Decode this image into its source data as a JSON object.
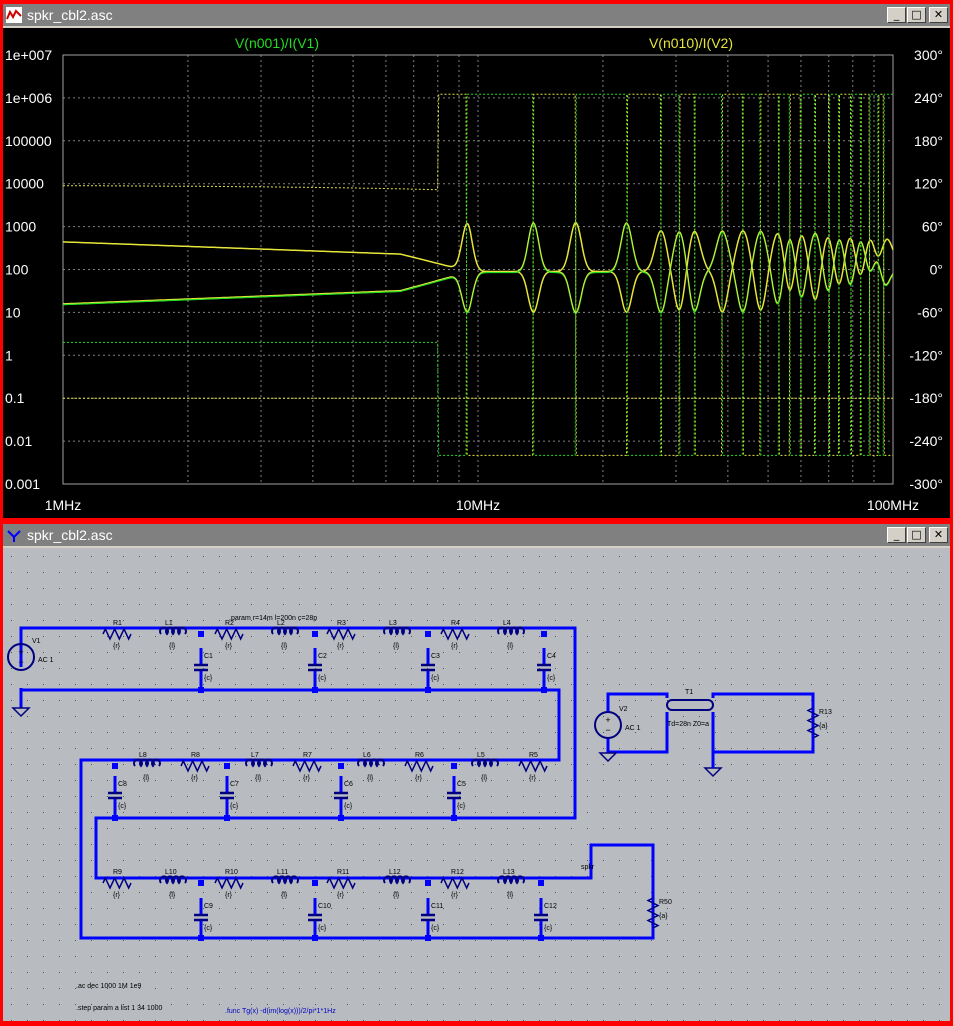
{
  "windows": {
    "waveform": {
      "title": "spkr_cbl2.asc"
    },
    "schematic": {
      "title": "spkr_cbl2.asc"
    }
  },
  "window_buttons": {
    "minimize": "_",
    "maximize": "□",
    "close": "✕"
  },
  "colors": {
    "trace1": "#22dd22",
    "trace2": "#e6e63a",
    "wire": "#0000ff",
    "component": "#000080"
  },
  "chart_data": {
    "type": "line",
    "series": [
      {
        "name": "V(n001)/I(V1)"
      },
      {
        "name": "V(n010)/I(V2)"
      }
    ],
    "x_scale": "log",
    "xlim": [
      "1MHz",
      "100MHz"
    ],
    "x_ticks": [
      "1MHz",
      "10MHz",
      "100MHz"
    ],
    "y_scale": "log",
    "ylim": [
      0.001,
      10000000
    ],
    "y_ticks": [
      "1e+007",
      "1e+006",
      "100000",
      "10000",
      "1000",
      "100",
      "10",
      "1",
      "0.1",
      "0.01",
      "0.001"
    ],
    "y2_ticks": [
      "300°",
      "240°",
      "180°",
      "120°",
      "60°",
      "0°",
      "-60°",
      "-120°",
      "-180°",
      "-240°",
      "-300°"
    ],
    "y2lim": [
      -300,
      300
    ],
    "grid": true
  },
  "schematic": {
    "param": ".param r=14m l=200n c=28p",
    "ac_cmd": ".ac dec 1000 1M 1e9",
    "step_cmd": ".step param a list 1 34 1000",
    "func_cmd": ".func Tg(x) -d(im(log(x)))/2/pi*1*1Hz",
    "net_spkr": "spkr",
    "v1": {
      "name": "V1",
      "value": "AC 1"
    },
    "v2": {
      "name": "V2",
      "value": "AC 1"
    },
    "t1": {
      "name": "T1",
      "value": "Td=28n Z0=a"
    },
    "r13": {
      "name": "R13",
      "value": "{a}"
    },
    "r50": {
      "name": "R50",
      "value": "{a}"
    },
    "val_r": "{r}",
    "val_l": "{l}",
    "val_c": "{c}",
    "row1": [
      {
        "r": "R1",
        "l": "L1",
        "c": "C1"
      },
      {
        "r": "R2",
        "l": "L2",
        "c": "C2"
      },
      {
        "r": "R3",
        "l": "L3",
        "c": "C3"
      },
      {
        "r": "R4",
        "l": "L4",
        "c": "C4"
      }
    ],
    "row2": [
      {
        "l": "L8",
        "r": "R8",
        "c": "C8"
      },
      {
        "l": "L7",
        "r": "R7",
        "c": "C7"
      },
      {
        "l": "L6",
        "r": "R6",
        "c": "C6"
      },
      {
        "l": "L5",
        "r": "R5",
        "c": "C5"
      }
    ],
    "row3": [
      {
        "r": "R9",
        "l": "L10",
        "c": "C9"
      },
      {
        "r": "R10",
        "l": "L11",
        "c": "C10"
      },
      {
        "r": "R11",
        "l": "L12",
        "c": "C11"
      },
      {
        "r": "R12",
        "l": "L13",
        "c": "C12"
      }
    ]
  }
}
